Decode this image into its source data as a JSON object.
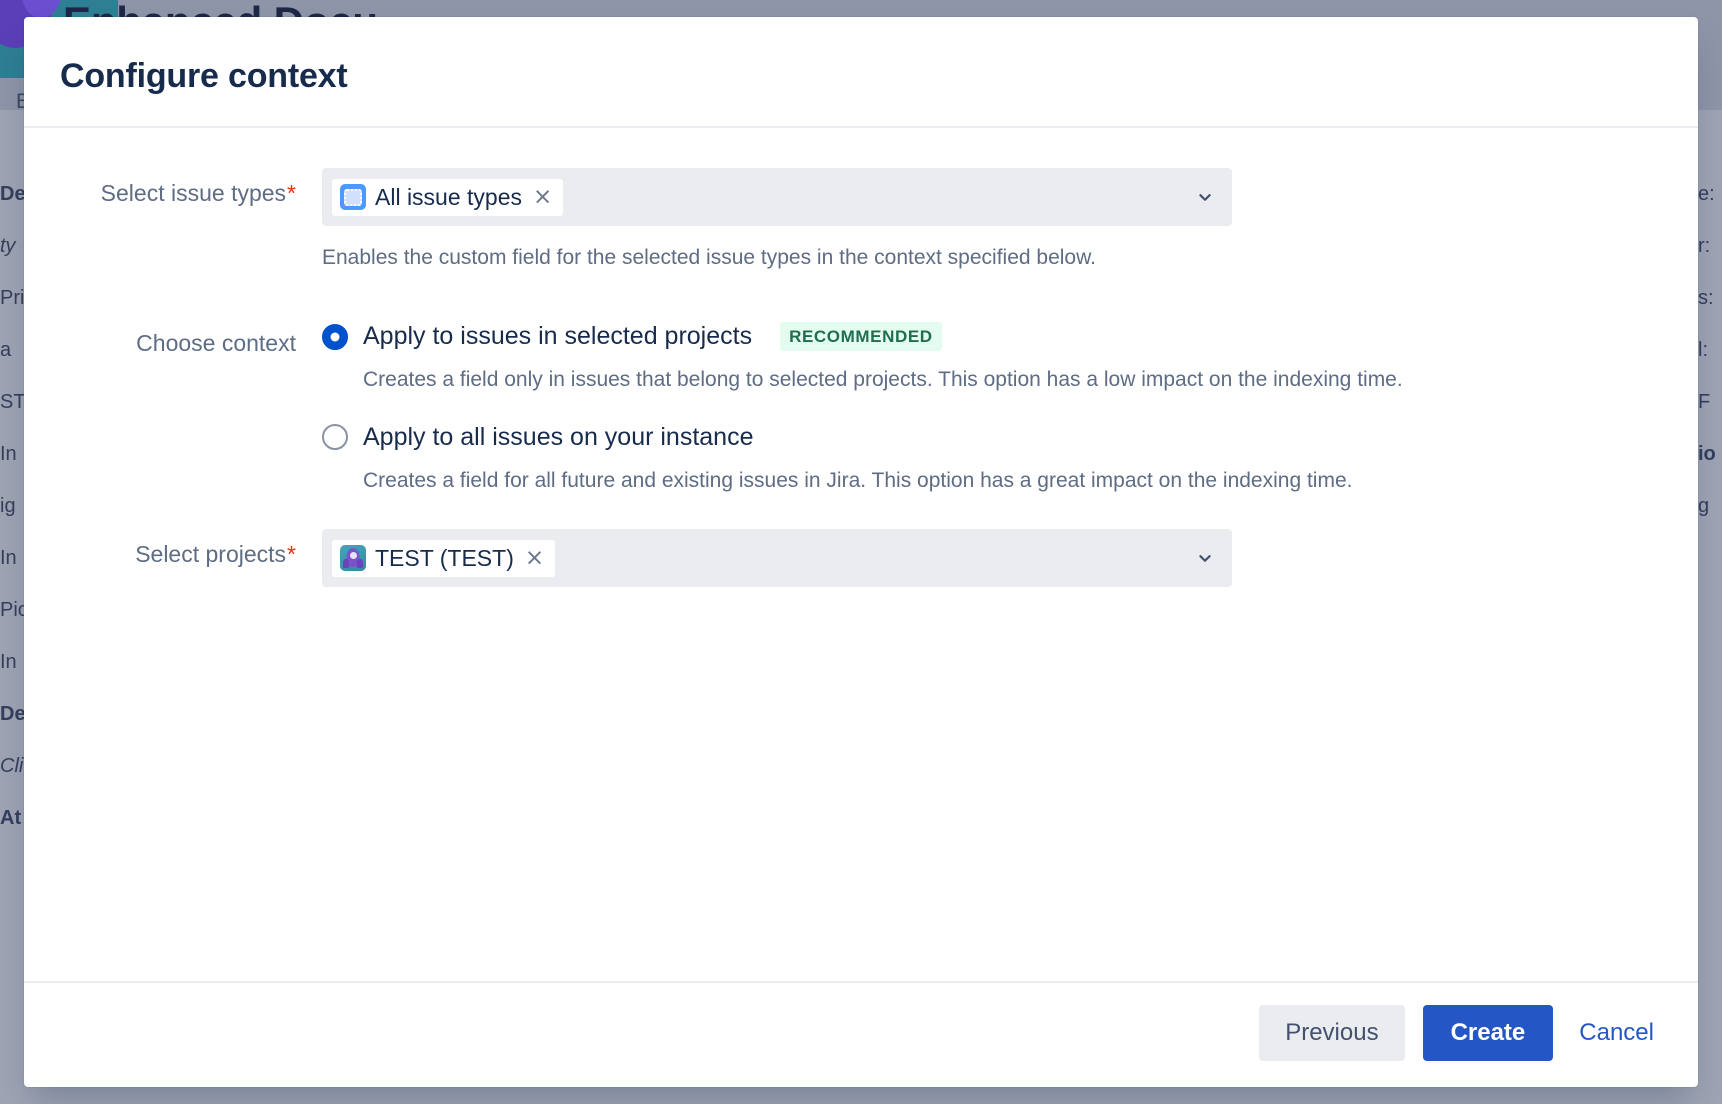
{
  "background": {
    "app_title": "Enhanced Docu",
    "tab_label": "E",
    "left_column_fragments": [
      "De",
      "ty",
      "Pri",
      "a",
      "ST",
      "In",
      "ig",
      "In",
      "Pic",
      "In",
      "De",
      "Cli",
      "At"
    ],
    "right_column_fragments": [
      "e:",
      "r:",
      "s:",
      "l:",
      "F",
      "io",
      "g"
    ]
  },
  "modal": {
    "title": "Configure context",
    "issue_types": {
      "label": "Select issue types",
      "required": true,
      "chips": [
        {
          "label": "All issue types",
          "icon": "all-issue-types-icon",
          "remove_glyph": "×"
        }
      ],
      "chevron_icon": "chevron-down-icon",
      "helper_text": "Enables the custom field for the selected issue types in the context specified below."
    },
    "context": {
      "label": "Choose context",
      "options": [
        {
          "label": "Apply to issues in selected projects",
          "badge": "RECOMMENDED",
          "selected": true,
          "description": "Creates a field only in issues that belong to selected projects. This option has a low impact on the indexing time."
        },
        {
          "label": "Apply to all issues on your instance",
          "badge": "",
          "selected": false,
          "description": "Creates a field for all future and existing issues in Jira. This option has a great impact on the indexing time."
        }
      ]
    },
    "projects": {
      "label": "Select projects",
      "required": true,
      "chips": [
        {
          "label": "TEST (TEST)",
          "icon": "project-avatar-icon",
          "remove_glyph": "×"
        }
      ],
      "chevron_icon": "chevron-down-icon"
    },
    "footer": {
      "previous_label": "Previous",
      "create_label": "Create",
      "cancel_label": "Cancel"
    }
  },
  "colors": {
    "primary": "#2457c5",
    "link": "#2457c5",
    "badge_bg": "#e3fcef",
    "badge_text": "#216e4e",
    "required_asterisk": "#de350b",
    "radio_selected": "#0052cc",
    "field_bg": "#ebecf0"
  }
}
